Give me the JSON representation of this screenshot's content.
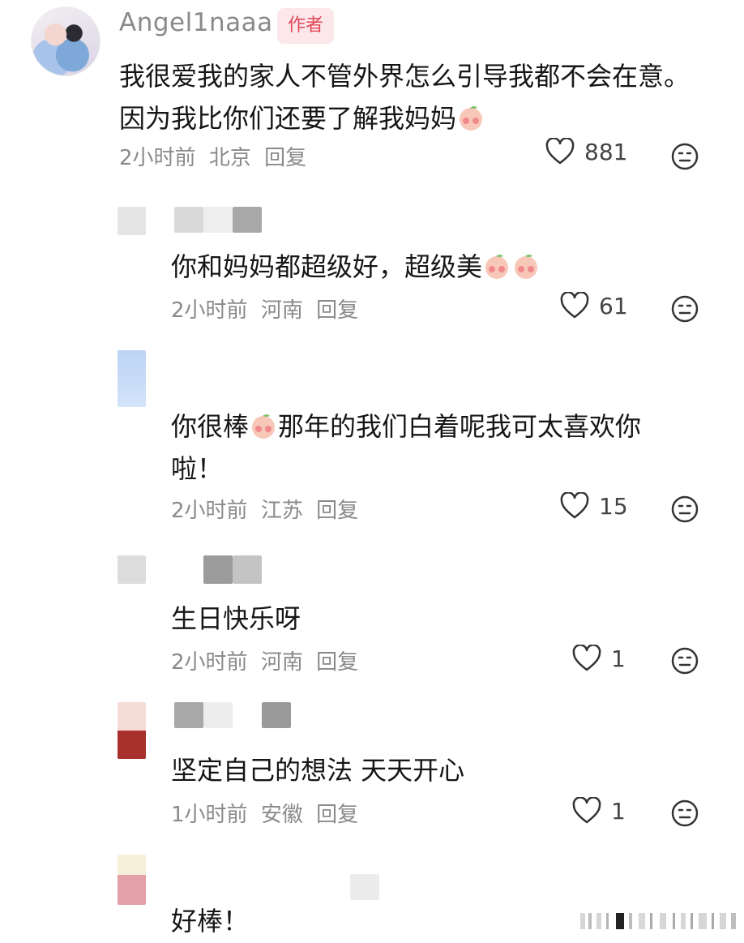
{
  "author": {
    "name": "Angel1naaa",
    "badge": "作者",
    "text": "我很爱我的家人不管外界怎么引导我都不会在意。因为我比你们还要了解我妈妈",
    "time": "2小时前",
    "location": "北京",
    "reply": "回复",
    "likes": "881"
  },
  "replies": [
    {
      "text": "你和妈妈都超级好，超级美",
      "time": "2小时前",
      "location": "河南",
      "reply": "回复",
      "likes": "61"
    },
    {
      "text": "你很棒",
      "text2": "那年的我们白着呢我可太喜欢你",
      "text3": "啦！",
      "time": "2小时前",
      "location": "江苏",
      "reply": "回复",
      "likes": "15"
    },
    {
      "text": "生日快乐呀",
      "time": "2小时前",
      "location": "河南",
      "reply": "回复",
      "likes": "1"
    },
    {
      "text": "坚定自己的想法 天天开心",
      "time": "1小时前",
      "location": "安徽",
      "reply": "回复",
      "likes": "1"
    },
    {
      "text": "好棒！"
    }
  ],
  "colors": {
    "badge_bg": "#fce8ea",
    "badge_text": "#e2485a",
    "meta": "#8a8a8a"
  },
  "icons": [
    "heart-outline-icon",
    "neutral-face-icon",
    "peach-emoji-icon"
  ]
}
